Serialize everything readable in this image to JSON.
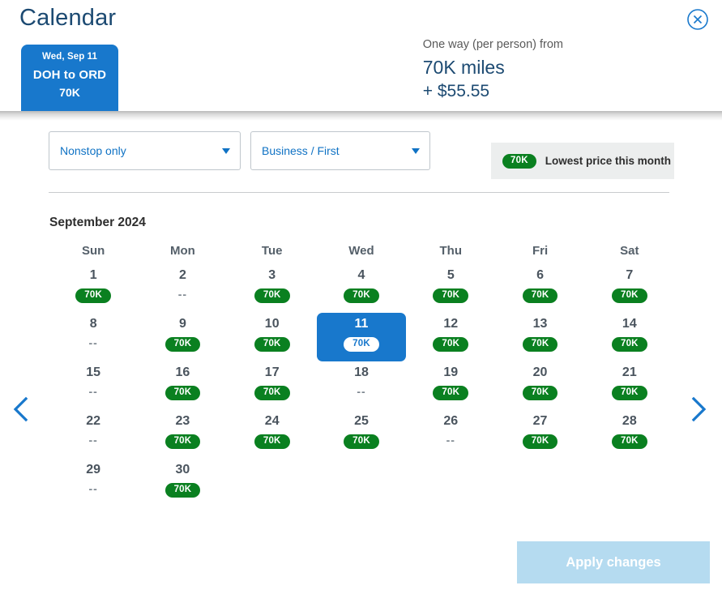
{
  "header": {
    "title": "Calendar",
    "close_icon": "close-circle-icon",
    "flight_tab": {
      "date": "Wed, Sep 11",
      "route": "DOH to ORD",
      "miles": "70K"
    },
    "price": {
      "label": "One way (per person) from",
      "miles": "70K miles",
      "cash": "+ $55.55"
    }
  },
  "filters": {
    "stops": {
      "value": "Nonstop only",
      "icon": "chevron-down-icon"
    },
    "cabin": {
      "value": "Business / First",
      "icon": "chevron-down-icon"
    },
    "legend": {
      "badge": "70K",
      "text": "Lowest price this month"
    }
  },
  "calendar": {
    "month_label": "September 2024",
    "weekdays": [
      "Sun",
      "Mon",
      "Tue",
      "Wed",
      "Thu",
      "Fri",
      "Sat"
    ],
    "prev_icon": "chevron-left-icon",
    "next_icon": "chevron-right-icon",
    "no_price_marker": "--",
    "weeks": [
      [
        {
          "day": "1",
          "price": "70K",
          "available": true,
          "selected": false
        },
        {
          "day": "2",
          "price": "--",
          "available": false,
          "selected": false
        },
        {
          "day": "3",
          "price": "70K",
          "available": true,
          "selected": false
        },
        {
          "day": "4",
          "price": "70K",
          "available": true,
          "selected": false
        },
        {
          "day": "5",
          "price": "70K",
          "available": true,
          "selected": false
        },
        {
          "day": "6",
          "price": "70K",
          "available": true,
          "selected": false
        },
        {
          "day": "7",
          "price": "70K",
          "available": true,
          "selected": false
        }
      ],
      [
        {
          "day": "8",
          "price": "--",
          "available": false,
          "selected": false
        },
        {
          "day": "9",
          "price": "70K",
          "available": true,
          "selected": false
        },
        {
          "day": "10",
          "price": "70K",
          "available": true,
          "selected": false
        },
        {
          "day": "11",
          "price": "70K",
          "available": true,
          "selected": true
        },
        {
          "day": "12",
          "price": "70K",
          "available": true,
          "selected": false
        },
        {
          "day": "13",
          "price": "70K",
          "available": true,
          "selected": false
        },
        {
          "day": "14",
          "price": "70K",
          "available": true,
          "selected": false
        }
      ],
      [
        {
          "day": "15",
          "price": "--",
          "available": false,
          "selected": false
        },
        {
          "day": "16",
          "price": "70K",
          "available": true,
          "selected": false
        },
        {
          "day": "17",
          "price": "70K",
          "available": true,
          "selected": false
        },
        {
          "day": "18",
          "price": "--",
          "available": false,
          "selected": false
        },
        {
          "day": "19",
          "price": "70K",
          "available": true,
          "selected": false
        },
        {
          "day": "20",
          "price": "70K",
          "available": true,
          "selected": false
        },
        {
          "day": "21",
          "price": "70K",
          "available": true,
          "selected": false
        }
      ],
      [
        {
          "day": "22",
          "price": "--",
          "available": false,
          "selected": false
        },
        {
          "day": "23",
          "price": "70K",
          "available": true,
          "selected": false
        },
        {
          "day": "24",
          "price": "70K",
          "available": true,
          "selected": false
        },
        {
          "day": "25",
          "price": "70K",
          "available": true,
          "selected": false
        },
        {
          "day": "26",
          "price": "--",
          "available": false,
          "selected": false
        },
        {
          "day": "27",
          "price": "70K",
          "available": true,
          "selected": false
        },
        {
          "day": "28",
          "price": "70K",
          "available": true,
          "selected": false
        }
      ],
      [
        {
          "day": "29",
          "price": "--",
          "available": false,
          "selected": false
        },
        {
          "day": "30",
          "price": "70K",
          "available": true,
          "selected": false
        },
        {
          "day": "",
          "price": "",
          "available": false,
          "selected": false
        },
        {
          "day": "",
          "price": "",
          "available": false,
          "selected": false
        },
        {
          "day": "",
          "price": "",
          "available": false,
          "selected": false
        },
        {
          "day": "",
          "price": "",
          "available": false,
          "selected": false
        },
        {
          "day": "",
          "price": "",
          "available": false,
          "selected": false
        }
      ]
    ]
  },
  "footer": {
    "apply_label": "Apply changes"
  },
  "colors": {
    "brand_blue": "#1878cc",
    "link_blue": "#0f72c4",
    "title_navy": "#1c4a72",
    "price_green": "#0a8020",
    "apply_disabled": "#b5dbf0"
  }
}
